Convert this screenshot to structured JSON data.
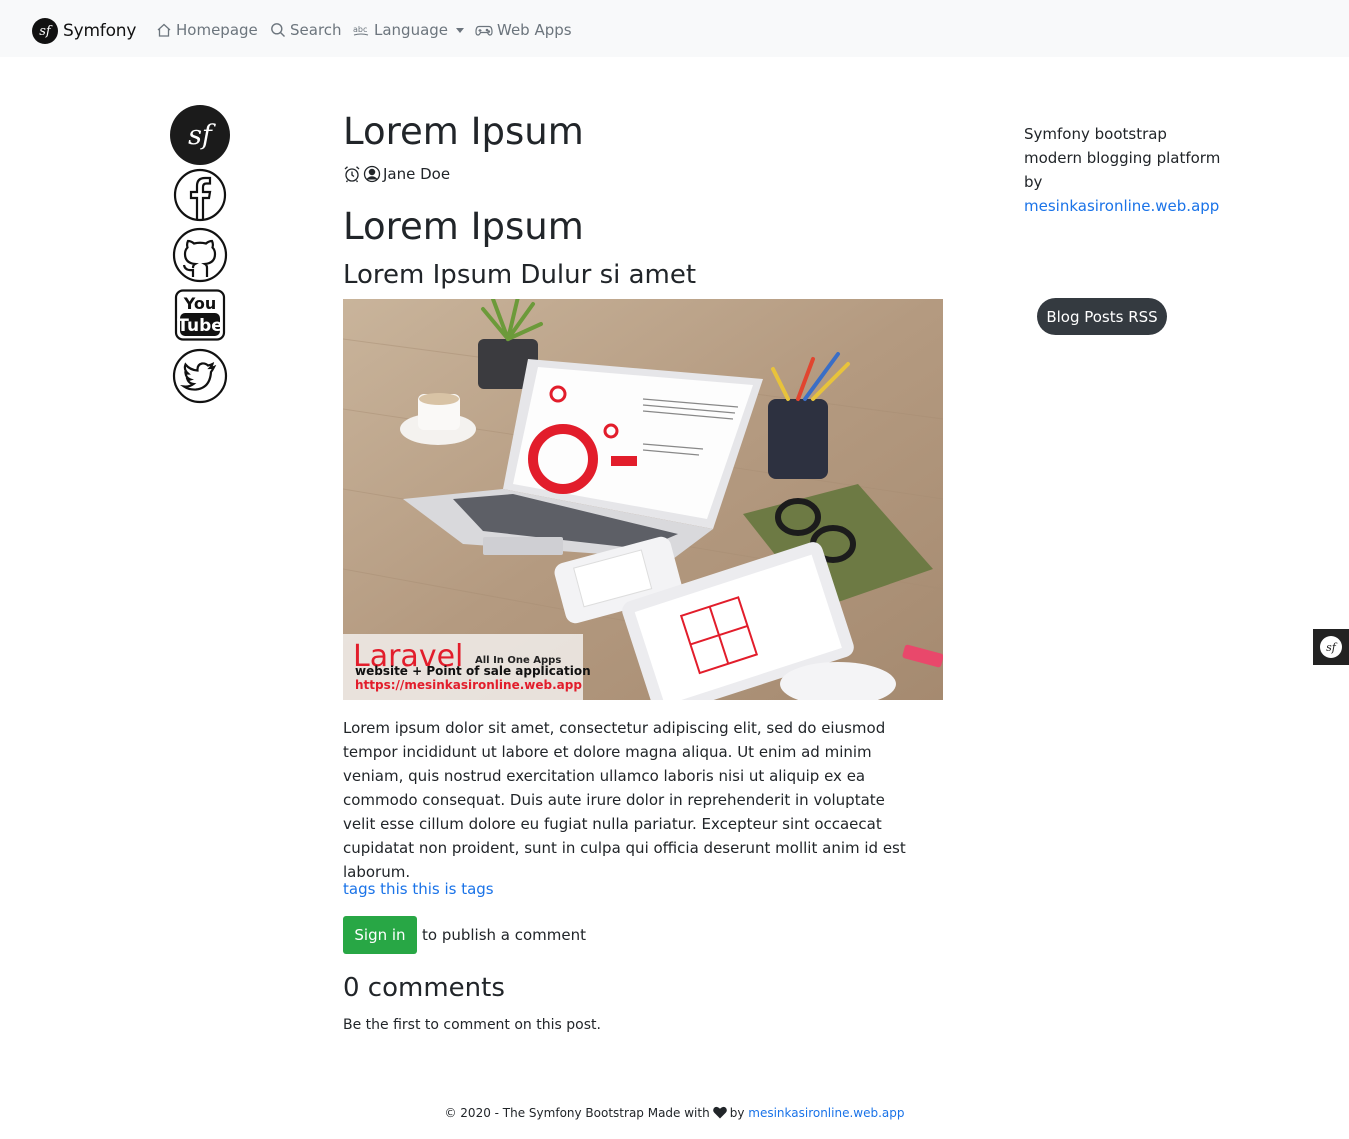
{
  "navbar": {
    "brand": "Symfony",
    "brand_logo_glyph": "sf",
    "items": [
      {
        "label": "Homepage",
        "icon": "home-icon"
      },
      {
        "label": "Search",
        "icon": "search-icon"
      },
      {
        "label": "Language",
        "icon": "language-icon",
        "dropdown": true
      },
      {
        "label": "Web Apps",
        "icon": "gamepad-icon"
      }
    ]
  },
  "social": [
    {
      "name": "symfony",
      "icon": "symfony-logo-icon"
    },
    {
      "name": "facebook",
      "icon": "facebook-icon"
    },
    {
      "name": "github",
      "icon": "github-icon"
    },
    {
      "name": "youtube",
      "icon": "youtube-icon",
      "text_top": "You",
      "text_bottom": "Tube"
    },
    {
      "name": "twitter",
      "icon": "twitter-icon"
    }
  ],
  "post": {
    "title": "Lorem Ipsum",
    "author": "Jane Doe",
    "heading": "Lorem Ipsum",
    "subheading": "Lorem Ipsum Dulur si amet",
    "image_caption": {
      "brand": "Laravel",
      "tagline": "All In One Apps",
      "line2": "website + Point of sale application",
      "url": "https://mesinkasironline.web.app"
    },
    "body": "Lorem ipsum dolor sit amet, consectetur adipiscing elit, sed do eiusmod tempor incididunt ut labore et dolore magna aliqua. Ut enim ad minim veniam, quis nostrud exercitation ullamco laboris nisi ut aliquip ex ea commodo consequat. Duis aute irure dolor in reprehenderit in voluptate velit esse cillum dolore eu fugiat nulla pariatur. Excepteur sint occaecat cupidatat non proident, sunt in culpa qui officia deserunt mollit anim id est laborum.",
    "tags": "tags this this is tags"
  },
  "comments": {
    "signin_label": "Sign in",
    "signin_suffix": "to publish a comment",
    "count_title": "0 comments",
    "empty_note": "Be the first to comment on this post."
  },
  "sidebar": {
    "about_text": "Symfony bootstrap modern blogging platform by",
    "about_link": "mesinkasironline.web.app",
    "rss_label": "Blog Posts RSS"
  },
  "footer": {
    "prefix": "© 2020 - The Symfony Bootstrap Made with",
    "by": "by",
    "link": "mesinkasironline.web.app"
  },
  "colors": {
    "navbar_bg": "#f8f9fa",
    "link": "#1a73e8",
    "success": "#28a745",
    "dark": "#343a40"
  }
}
